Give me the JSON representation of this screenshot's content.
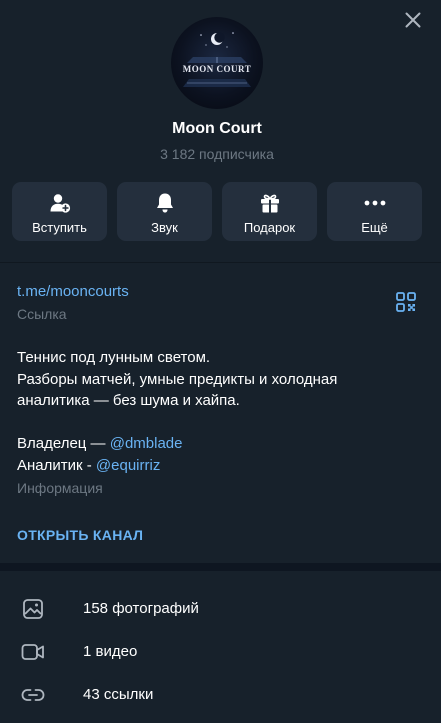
{
  "channel": {
    "name": "Moon Court",
    "subscribers": "3 182 подписчика",
    "avatar_text": "MOON COURT"
  },
  "actions": [
    {
      "label": "Вступить",
      "icon": "join-icon"
    },
    {
      "label": "Звук",
      "icon": "bell-icon"
    },
    {
      "label": "Подарок",
      "icon": "gift-icon"
    },
    {
      "label": "Ещё",
      "icon": "more-icon"
    }
  ],
  "info": {
    "link": "t.me/mooncourts",
    "link_caption": "Ссылка",
    "description_lines": [
      "Теннис под лунным светом.",
      "Разборы матчей, умные предикты и холодная",
      "аналитика — без шума и хайпа."
    ],
    "owner_label": "Владелец — ",
    "owner_mention": "@dmblade",
    "analyst_label": "Аналитик - ",
    "analyst_mention": "@equirriz",
    "info_caption": "Информация",
    "open_channel": "ОТКРЫТЬ КАНАЛ"
  },
  "media": [
    {
      "label": "158 фотографий",
      "icon": "photo-icon"
    },
    {
      "label": "1 видео",
      "icon": "video-icon"
    },
    {
      "label": "43 ссылки",
      "icon": "link-icon"
    }
  ],
  "colors": {
    "background": "#17212b",
    "card": "#242f3d",
    "accent": "#6ab3f3",
    "muted": "#6d7883"
  }
}
